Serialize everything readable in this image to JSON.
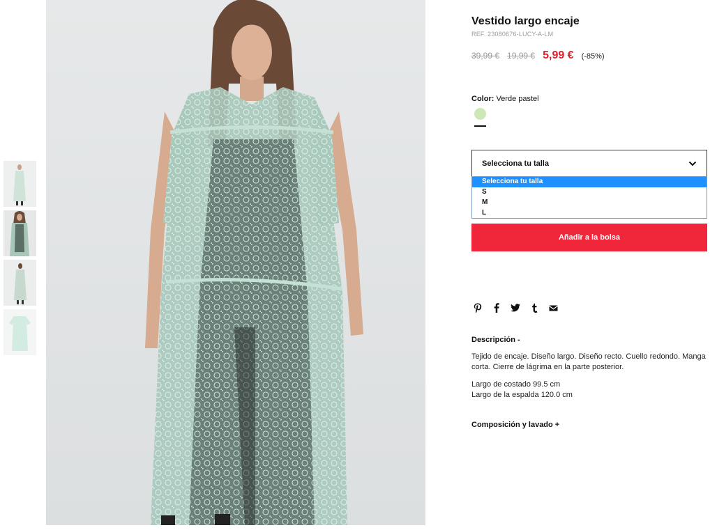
{
  "product": {
    "title": "Vestido largo encaje",
    "ref": "REF. 23080676-LUCY-A-LM",
    "price_original": "39,99 €",
    "price_previous": "19,99 €",
    "price_current": "5,99 €",
    "discount": "(-85%)"
  },
  "color": {
    "label": "Color:",
    "value": "Verde pastel",
    "swatch_color": "#cde8b6"
  },
  "size": {
    "select_label": "Selecciona tu talla",
    "options": [
      "Selecciona tu talla",
      "S",
      "M",
      "L"
    ],
    "selected_index": 0
  },
  "actions": {
    "add_to_bag": "Añadir a la bolsa"
  },
  "share": {
    "icons": [
      "pinterest-icon",
      "facebook-icon",
      "twitter-icon",
      "tumblr-icon",
      "email-icon"
    ]
  },
  "description": {
    "title": "Descripción -",
    "text": "Tejido de encaje. Diseño largo. Diseño recto. Cuello redondo. Manga corta. Cierre de lágrima en la parte posterior.",
    "measure_1": "Largo de costado 99.5 cm",
    "measure_2": "Largo de la espalda 120.0 cm"
  },
  "composition": {
    "title": "Composición y lavado +"
  },
  "colors": {
    "accent": "#f0273a",
    "price_sale": "#e51c2c",
    "muted": "#9a9a9a",
    "dropdown_highlight": "#1e90ff"
  }
}
